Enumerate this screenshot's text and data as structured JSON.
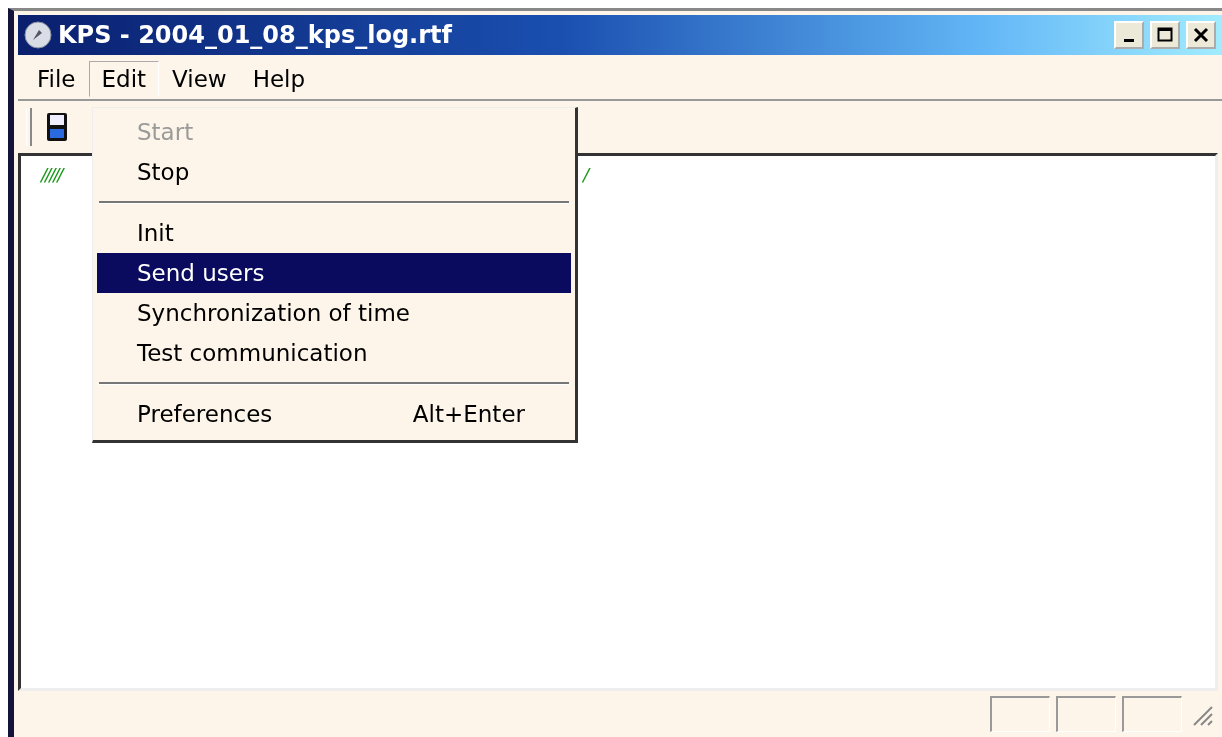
{
  "window": {
    "title": "KPS - 2004_01_08_kps_log.rtf"
  },
  "menu_bar": [
    {
      "label": "File",
      "selected": false
    },
    {
      "label": "Edit",
      "selected": true
    },
    {
      "label": "View",
      "selected": false
    },
    {
      "label": "Help",
      "selected": false
    }
  ],
  "edit_menu": [
    {
      "kind": "item",
      "label": "Start",
      "disabled": true,
      "selected": false
    },
    {
      "kind": "item",
      "label": "Stop",
      "disabled": false,
      "selected": false
    },
    {
      "kind": "separator"
    },
    {
      "kind": "item",
      "label": "Init",
      "disabled": false,
      "selected": false
    },
    {
      "kind": "item",
      "label": "Send users",
      "disabled": false,
      "selected": true
    },
    {
      "kind": "item",
      "label": "Synchronization of time",
      "disabled": false,
      "selected": false
    },
    {
      "kind": "item",
      "label": "Test communication",
      "disabled": false,
      "selected": false
    },
    {
      "kind": "separator"
    },
    {
      "kind": "item",
      "label": "Preferences",
      "shortcut": "Alt+Enter",
      "disabled": false,
      "selected": false
    }
  ],
  "log_fragments": [
    "/////",
    "/"
  ]
}
